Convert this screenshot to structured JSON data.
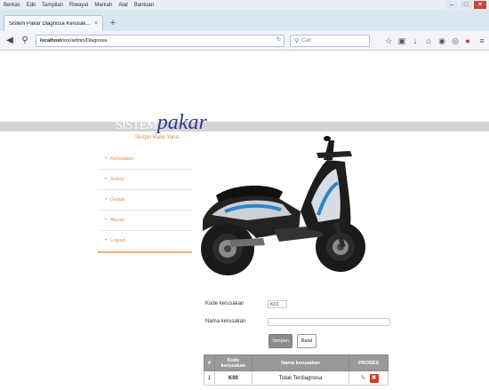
{
  "browser": {
    "menu": [
      "Berkas",
      "Edit",
      "Tampilan",
      "Riwayat",
      "Markah",
      "Alat",
      "Bantuan"
    ],
    "tab_title": "Sistem Pakar Diagnosa Kerusak...",
    "tab_close": "×",
    "new_tab": "+",
    "url_host": "localhost",
    "url_path": "/xxx/admin/Diagnosa",
    "reload": "↻",
    "search_placeholder": "Cari"
  },
  "page": {
    "brand_sistem": "SISTEM",
    "brand_pakar": "pakar",
    "tagline": "Skripsi Malik Yana",
    "sidebar": [
      "Kerusakan",
      "Solusi",
      "Gejala",
      "Aturan",
      "Logout"
    ],
    "form": {
      "kode_label": "Kode kerusakan",
      "kode_value": "K01",
      "nama_label": "Nama kerusakan",
      "nama_value": "",
      "save_label": "Simpan",
      "cancel_label": "Batal"
    },
    "table": {
      "headers": [
        "#",
        "Kode kerusakan",
        "Nama kerusakan",
        "PROSES"
      ],
      "rows": [
        {
          "no": "1",
          "kode": "K00",
          "nama": "Tidak Terdiagnosa"
        }
      ]
    }
  },
  "colors": {
    "accent_orange": "#e58a4a",
    "brand_blue": "#2f3a8c",
    "table_header": "#9a9a9a"
  },
  "icons": {
    "edit": "edit-icon",
    "delete": "delete-icon"
  }
}
